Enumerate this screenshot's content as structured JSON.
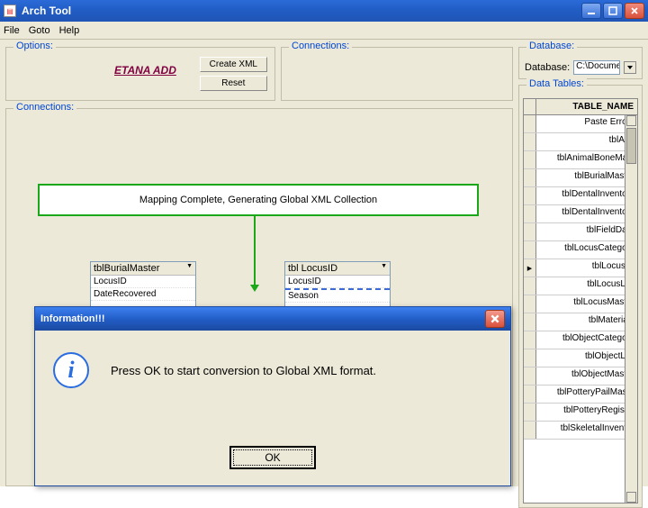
{
  "window": {
    "title": "Arch Tool"
  },
  "menu": {
    "file": "File",
    "goto": "Goto",
    "help": "Help"
  },
  "options": {
    "title": "Options:",
    "link": "ETANA ADD",
    "create_btn": "Create XML",
    "reset_btn": "Reset"
  },
  "connections_top": {
    "title": "Connections:"
  },
  "database": {
    "title": "Database:",
    "label": "Database:",
    "value": "C:\\Documents a"
  },
  "datatables": {
    "title": "Data Tables:",
    "col_header": "TABLE_NAME",
    "rows": [
      "Paste Errors",
      "tblAge",
      "tblAnimalBoneMast",
      "tblBurialMaster",
      "tblDentalInventory",
      "tblDentalInventory",
      "tblFieldData",
      "tblLocusCategory",
      "tblLocusID",
      "tblLocusList",
      "tblLocusMaster",
      "tblMaterials",
      "tblObjectCategory",
      "tblObjectList",
      "tblObjectMaster",
      "tblPotteryPailMaste",
      "tblPotteryRegistry",
      "tblSkeletalInventor"
    ]
  },
  "connections_main": {
    "title": "Connections:"
  },
  "status": "Mapping Complete, Generating Global XML Collection",
  "listbox1": {
    "title": "tblBurialMaster",
    "items": [
      "LocusID",
      "DateRecovered"
    ]
  },
  "listbox2": {
    "title": "tbl LocusID",
    "items": [
      "LocusID",
      "Season"
    ]
  },
  "modal": {
    "title": "Information!!!",
    "body": "Press OK to start conversion to Global XML format.",
    "ok": "OK"
  }
}
